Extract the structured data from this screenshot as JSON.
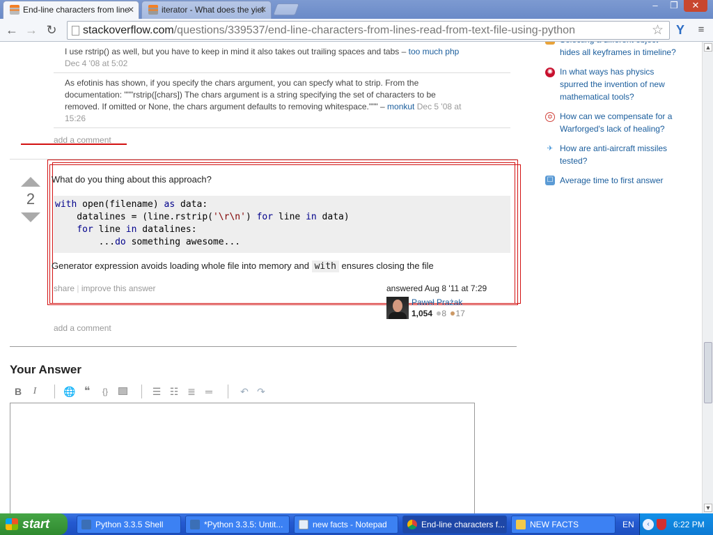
{
  "window": {
    "tabs": [
      {
        "title": "End-line characters from line",
        "active": true
      },
      {
        "title": "iterator - What does the yiel",
        "active": false
      }
    ],
    "controls": {
      "minimize": "–",
      "maximize": "❐",
      "close": "✕"
    }
  },
  "toolbar": {
    "url_domain": "stackoverflow.com",
    "url_path": "/questions/339537/end-line-characters-from-lines-read-from-text-file-using-python"
  },
  "comments": [
    {
      "text": "I use rstrip() as well, but you have to keep in mind it also takes out trailing spaces and tabs –",
      "user": "too much php",
      "date": "Dec 4 '08 at 5:02"
    },
    {
      "text_l1": "As efotinis has shown, if you specify the chars argument, you can specfy what to strip. From the",
      "text_l2": "documentation: \"\"\"rstrip([chars]) The chars argument is a string specifying the set of characters to be",
      "text_l3": "removed. If omitted or None, the chars argument defaults to removing whitespace.\"\"\" –",
      "user": "monkut",
      "date_l1": "Dec 5 '08 at",
      "date_l2": "15:26"
    }
  ],
  "add_comment_label": "add a comment",
  "answer": {
    "votes": "2",
    "intro": "What do you thing about this approach?",
    "code_lines": [
      "with open(filename) as data:",
      "    datalines = (line.rstrip('\\r\\n') for line in data)",
      "    for line in datalines:",
      "        ...do something awesome..."
    ],
    "explain_before": "Generator expression avoids loading whole file into memory and",
    "explain_code": "with",
    "explain_after": "ensures closing the file",
    "share": "share",
    "improve": "improve this answer",
    "answered": "answered Aug 8 '11 at 7:29",
    "user_name": "Paweł Prażak",
    "reputation": "1,054",
    "silver": "8",
    "bronze": "17"
  },
  "your_answer": {
    "title": "Your Answer",
    "bold": "B",
    "italic": "I"
  },
  "hot_questions": [
    {
      "l1": "Selecting a different object",
      "l2": "hides all keyframes in timeline?",
      "icon_color": "#e8a33a"
    },
    {
      "l1": "In what ways has physics",
      "l2": "spurred the invention of new",
      "l3": "mathematical tools?",
      "icon_color": "#c8102e"
    },
    {
      "l1": "How can we compensate for a",
      "l2": "Warforged's lack of healing?",
      "icon_color": "#d0413a"
    },
    {
      "l1": "How are anti-aircraft missiles",
      "l2": "tested?",
      "icon_color": "#3a8fd6"
    },
    {
      "l1": "Average time to first answer",
      "icon_color": "#5b9bd5"
    }
  ],
  "taskbar": {
    "start": "start",
    "items": [
      {
        "label": "Python 3.3.5 Shell"
      },
      {
        "label": "*Python 3.3.5: Untit..."
      },
      {
        "label": "new facts - Notepad"
      },
      {
        "label": "End-line characters f..."
      },
      {
        "label": "NEW FACTS"
      }
    ],
    "lang": "EN",
    "clock": "6:22 PM"
  }
}
